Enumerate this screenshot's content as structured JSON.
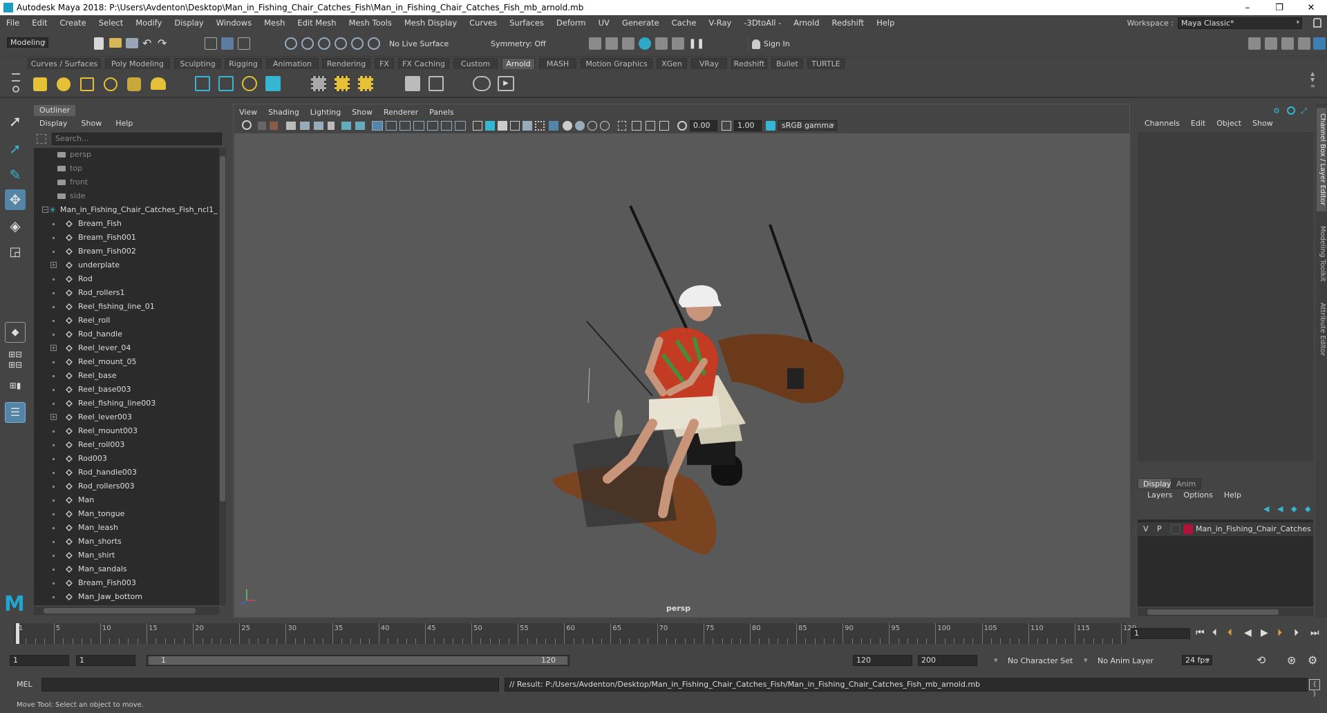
{
  "titlebar": {
    "title": "Autodesk Maya 2018: P:\\Users\\Avdenton\\Desktop\\Man_in_Fishing_Chair_Catches_Fish\\Man_in_Fishing_Chair_Catches_Fish_mb_arnold.mb",
    "minimize": "–",
    "restore": "❐",
    "close": "✕"
  },
  "menubar": {
    "items": [
      "File",
      "Edit",
      "Create",
      "Select",
      "Modify",
      "Display",
      "Windows",
      "Mesh",
      "Edit Mesh",
      "Mesh Tools",
      "Mesh Display",
      "Curves",
      "Surfaces",
      "Deform",
      "UV",
      "Generate",
      "Cache",
      "V-Ray",
      "-3DtoAll -",
      "Arnold",
      "Redshift",
      "Help"
    ],
    "workspace_label": "Workspace :",
    "workspace_value": "Maya Classic*"
  },
  "statusline": {
    "menuset": "Modeling",
    "live_surface": "No Live Surface",
    "symmetry": "Symmetry: Off",
    "sign_in": "Sign In"
  },
  "shelf": {
    "tabs": [
      "Curves / Surfaces",
      "Poly Modeling",
      "Sculpting",
      "Rigging",
      "Animation",
      "Rendering",
      "FX",
      "FX Caching",
      "Custom",
      "Arnold",
      "MASH",
      "Motion Graphics",
      "XGen",
      "VRay",
      "Redshift",
      "Bullet",
      "TURTLE"
    ],
    "active_tab": "Arnold"
  },
  "outliner": {
    "title": "Outliner",
    "menus": [
      "Display",
      "Show",
      "Help"
    ],
    "search_placeholder": "Search...",
    "items": [
      {
        "label": "persp",
        "type": "camera",
        "depth": 1,
        "dim": true
      },
      {
        "label": "top",
        "type": "camera",
        "depth": 1,
        "dim": true
      },
      {
        "label": "front",
        "type": "camera",
        "depth": 1,
        "dim": true
      },
      {
        "label": "side",
        "type": "camera",
        "depth": 1,
        "dim": true
      },
      {
        "label": "Man_in_Fishing_Chair_Catches_Fish_ncl1_",
        "type": "group",
        "depth": 0,
        "expander": "−"
      },
      {
        "label": "Bream_Fish",
        "type": "mesh",
        "depth": 1
      },
      {
        "label": "Bream_Fish001",
        "type": "mesh",
        "depth": 1
      },
      {
        "label": "Bream_Fish002",
        "type": "mesh",
        "depth": 1
      },
      {
        "label": "underplate",
        "type": "mesh",
        "depth": 1,
        "expander": "+"
      },
      {
        "label": "Rod",
        "type": "mesh",
        "depth": 1
      },
      {
        "label": "Rod_rollers1",
        "type": "mesh",
        "depth": 1
      },
      {
        "label": "Reel_fishing_line_01",
        "type": "mesh",
        "depth": 1
      },
      {
        "label": "Reel_roll",
        "type": "mesh",
        "depth": 1
      },
      {
        "label": "Rod_handle",
        "type": "mesh",
        "depth": 1
      },
      {
        "label": "Reel_lever_04",
        "type": "mesh",
        "depth": 1,
        "expander": "+"
      },
      {
        "label": "Reel_mount_05",
        "type": "mesh",
        "depth": 1
      },
      {
        "label": "Reel_base",
        "type": "mesh",
        "depth": 1
      },
      {
        "label": "Reel_base003",
        "type": "mesh",
        "depth": 1
      },
      {
        "label": "Reel_fishing_line003",
        "type": "mesh",
        "depth": 1
      },
      {
        "label": "Reel_lever003",
        "type": "mesh",
        "depth": 1,
        "expander": "+"
      },
      {
        "label": "Reel_mount003",
        "type": "mesh",
        "depth": 1
      },
      {
        "label": "Reel_roll003",
        "type": "mesh",
        "depth": 1
      },
      {
        "label": "Rod003",
        "type": "mesh",
        "depth": 1
      },
      {
        "label": "Rod_handle003",
        "type": "mesh",
        "depth": 1
      },
      {
        "label": "Rod_rollers003",
        "type": "mesh",
        "depth": 1
      },
      {
        "label": "Man",
        "type": "mesh",
        "depth": 1
      },
      {
        "label": "Man_tongue",
        "type": "mesh",
        "depth": 1
      },
      {
        "label": "Man_leash",
        "type": "mesh",
        "depth": 1
      },
      {
        "label": "Man_shorts",
        "type": "mesh",
        "depth": 1
      },
      {
        "label": "Man_shirt",
        "type": "mesh",
        "depth": 1
      },
      {
        "label": "Man_sandals",
        "type": "mesh",
        "depth": 1
      },
      {
        "label": "Bream_Fish003",
        "type": "mesh",
        "depth": 1
      },
      {
        "label": "Man_Jaw_bottom",
        "type": "mesh",
        "depth": 1
      }
    ]
  },
  "viewport": {
    "menus": [
      "View",
      "Shading",
      "Lighting",
      "Show",
      "Renderer",
      "Panels"
    ],
    "exposure": "0.00",
    "gamma": "1.00",
    "colorspace": "sRGB gamma",
    "camera": "persp"
  },
  "channelbox": {
    "menus": [
      "Channels",
      "Edit",
      "Object",
      "Show"
    ],
    "side_tabs": [
      "Channel Box / Layer Editor",
      "Modeling Toolkit",
      "Attribute Editor"
    ]
  },
  "layers": {
    "tabs": [
      "Display",
      "Anim"
    ],
    "active_tab": "Display",
    "menus": [
      "Layers",
      "Options",
      "Help"
    ],
    "rows": [
      {
        "v": "V",
        "p": "P",
        "name": "Man_in_Fishing_Chair_Catches",
        "color": "#b0133a"
      }
    ]
  },
  "timeline": {
    "ticks": [
      1,
      5,
      10,
      15,
      20,
      25,
      30,
      35,
      40,
      45,
      50,
      55,
      60,
      65,
      70,
      75,
      80,
      85,
      90,
      95,
      100,
      105,
      110,
      115,
      120
    ],
    "start": 1,
    "end": 120,
    "current_frame": "1"
  },
  "range": {
    "start_field": "1",
    "playback_start": "1",
    "slider_start": "1",
    "slider_end": "120",
    "playback_end": "120",
    "end_field": "200",
    "character_set": "No Character Set",
    "anim_layer": "No Anim Layer",
    "fps": "24 fps"
  },
  "commandline": {
    "lang": "MEL",
    "result": "// Result: P:/Users/Avdenton/Desktop/Man_in_Fishing_Chair_Catches_Fish/Man_in_Fishing_Chair_Catches_Fish_mb_arnold.mb"
  },
  "helpline": {
    "text": "Move Tool: Select an object to move."
  }
}
